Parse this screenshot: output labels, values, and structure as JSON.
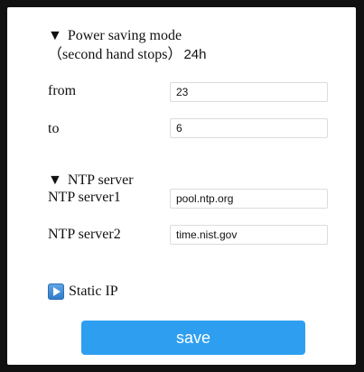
{
  "power_saving": {
    "title": "Power saving mode",
    "arrow": "▼",
    "subtitle_paren": "（second hand stops）",
    "subtitle_value": "24h",
    "from_label": "from",
    "from_value": "23",
    "to_label": "to",
    "to_value": "6"
  },
  "ntp": {
    "title": "NTP server",
    "arrow": "▼",
    "server1_label": "NTP server1",
    "server1_value": "pool.ntp.org",
    "server2_label": "NTP server2",
    "server2_value": "time.nist.gov"
  },
  "static_ip": {
    "label": "Static IP",
    "icon": "play-icon",
    "icon_color": "#3a8ad6"
  },
  "save_button": {
    "label": "save",
    "color": "#2e9ff0"
  }
}
